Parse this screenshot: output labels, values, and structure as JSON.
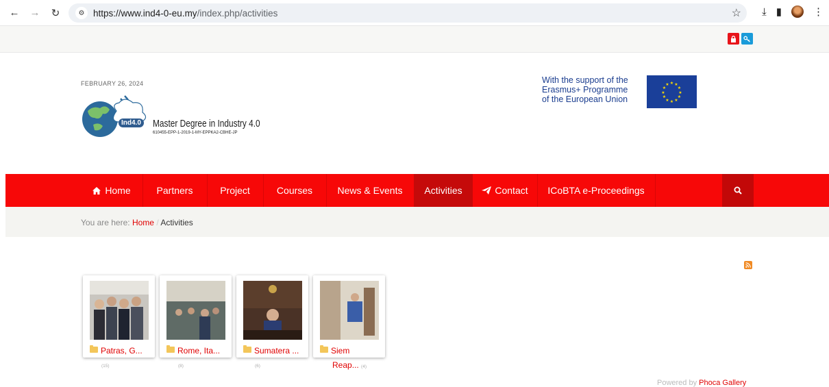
{
  "browser": {
    "url_host": "https://www.ind4-0-eu.my",
    "url_path": "/index.php/activities"
  },
  "header": {
    "date": "FEBRUARY 26, 2024",
    "logo_badge": "Ind4.0",
    "logo_title": "Master Degree in Industry 4.0",
    "logo_code": "610455-EPP-1-2019-1-MY-EPPKA2-CBHE-JP",
    "erasmus_line1": "With the support of the",
    "erasmus_line2": "Erasmus+ Programme",
    "erasmus_line3": "of the European Union"
  },
  "nav": {
    "items": [
      {
        "label": "Home",
        "icon": "home-icon"
      },
      {
        "label": "Partners"
      },
      {
        "label": "Project"
      },
      {
        "label": "Courses"
      },
      {
        "label": "News & Events"
      },
      {
        "label": "Activities",
        "active": true
      },
      {
        "label": "Contact",
        "icon": "paper-plane-icon"
      },
      {
        "label": "ICoBTA e-Proceedings"
      }
    ]
  },
  "breadcrumb": {
    "prefix": "You are here:",
    "home": "Home",
    "current": "Activities"
  },
  "gallery": {
    "categories": [
      {
        "label": "Patras, G...",
        "count": "(15)"
      },
      {
        "label": "Rome, Ita...",
        "count": "(8)"
      },
      {
        "label": "Sumatera ...",
        "count": "(6)"
      },
      {
        "label": "Siem",
        "label2": "Reap...",
        "count": "(4)"
      }
    ]
  },
  "footer": {
    "powered_prefix": "Powered by",
    "powered_link": "Phoca Gallery"
  },
  "colors": {
    "nav_red": "#f70808",
    "nav_active": "#c50a0a",
    "link_red": "#e00000"
  }
}
